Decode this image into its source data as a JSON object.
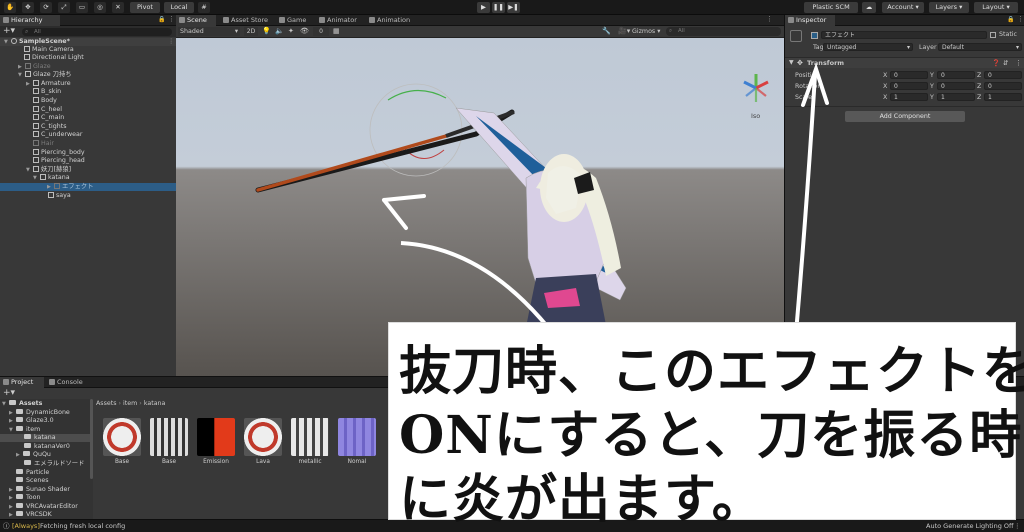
{
  "toolbar": {
    "pivot_label": "Pivot",
    "local_label": "Local",
    "plastic_label": "Plastic SCM",
    "account_label": "Account",
    "layers_label": "Layers",
    "layout_label": "Layout"
  },
  "hierarchy": {
    "tab_label": "Hierarchy",
    "search_placeholder": "All",
    "items": [
      {
        "label": "SampleScene*"
      },
      {
        "label": "Main Camera"
      },
      {
        "label": "Directional Light"
      },
      {
        "label": "Glaze"
      },
      {
        "label": "Glaze 刀持ち"
      },
      {
        "label": "Armature"
      },
      {
        "label": "B_skin"
      },
      {
        "label": "Body"
      },
      {
        "label": "C_heel"
      },
      {
        "label": "C_main"
      },
      {
        "label": "C_tights"
      },
      {
        "label": "C_underwear"
      },
      {
        "label": "Hair"
      },
      {
        "label": "Piercing_body"
      },
      {
        "label": "Piercing_head"
      },
      {
        "label": "妖刀[赫狼]"
      },
      {
        "label": "katana"
      },
      {
        "label": "エフェクト"
      },
      {
        "label": "saya"
      }
    ]
  },
  "scene": {
    "tabs": [
      {
        "label": "Scene"
      },
      {
        "label": "Asset Store"
      },
      {
        "label": "Game"
      },
      {
        "label": "Animator"
      },
      {
        "label": "Animation"
      }
    ],
    "shading_mode": "Shaded",
    "mode_2d": "2D",
    "hidden_count": "0",
    "gizmos_label": "Gizmos",
    "search_placeholder": "All",
    "persp_label": "Iso"
  },
  "inspector": {
    "tab_label": "Inspector",
    "object_name": "エフェクト",
    "static_label": "Static",
    "tag_label": "Tag",
    "tag_value": "Untagged",
    "layer_label": "Layer",
    "layer_value": "Default",
    "transform_title": "Transform",
    "rows": [
      {
        "label": "Position",
        "x": "0",
        "y": "0",
        "z": "0"
      },
      {
        "label": "Rotation",
        "x": "0",
        "y": "0",
        "z": "0"
      },
      {
        "label": "Scale",
        "x": "1",
        "y": "1",
        "z": "1"
      }
    ],
    "axis_x": "X",
    "axis_y": "Y",
    "axis_z": "Z",
    "add_component_label": "Add Component"
  },
  "project": {
    "tabs": [
      {
        "label": "Project"
      },
      {
        "label": "Console"
      }
    ],
    "tree": [
      {
        "label": "Assets"
      },
      {
        "label": "DynamicBone"
      },
      {
        "label": "Glaze3.0"
      },
      {
        "label": "item"
      },
      {
        "label": "katana"
      },
      {
        "label": "katanaVer0"
      },
      {
        "label": "QuQu"
      },
      {
        "label": "エメラルドソード"
      },
      {
        "label": "Particle"
      },
      {
        "label": "Scenes"
      },
      {
        "label": "Sunao Shader"
      },
      {
        "label": "Toon"
      },
      {
        "label": "VRCAvatarEditor"
      },
      {
        "label": "VRCSDK"
      }
    ],
    "breadcrumb": [
      "Assets",
      "item",
      "katana"
    ],
    "assets": [
      {
        "label": "Base"
      },
      {
        "label": "Base"
      },
      {
        "label": "Emission"
      },
      {
        "label": "Lava"
      },
      {
        "label": "metallic"
      },
      {
        "label": "Nomal"
      }
    ]
  },
  "status": {
    "tag": "[Always]",
    "message": "Fetching fresh local config",
    "right_text": "Auto Generate Lighting Off"
  },
  "caption": {
    "lines": [
      "抜刀時、このエフェクトを",
      "ONにすると、刀を振る時",
      "に炎が出ます。"
    ]
  },
  "colors": {
    "selection": "#2c5d87",
    "panel": "#383838",
    "sword_blade": "#b04a1c",
    "annotation": "#ffffff"
  }
}
